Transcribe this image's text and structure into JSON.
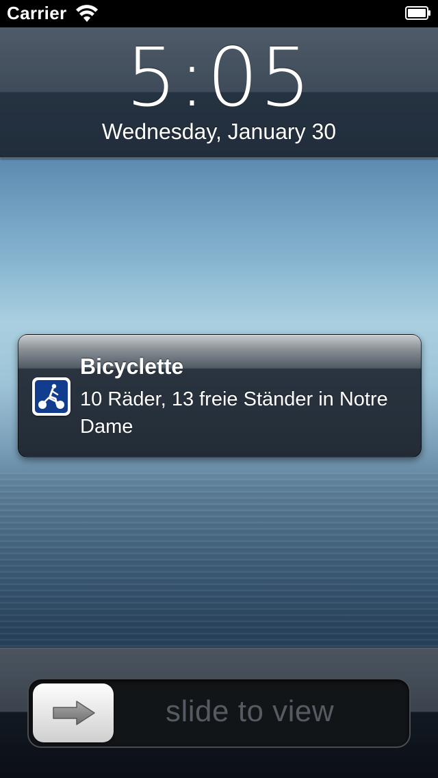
{
  "status_bar": {
    "carrier": "Carrier",
    "wifi_icon": "wifi-icon",
    "battery_icon": "battery-icon"
  },
  "lock_screen": {
    "time": "5:05",
    "date": "Wednesday, January 30"
  },
  "notification": {
    "app_name": "Bicyclette",
    "message": "10 Räder, 13 freie Ständer in Notre Dame",
    "icon": "bicycle-app-icon",
    "icon_color": "#123d8f"
  },
  "unlock_slider": {
    "label": "slide to view",
    "knob_icon": "arrow-right-icon"
  },
  "colors": {
    "status_bar_bg": "#000000",
    "text": "#ffffff",
    "slider_text": "#555b62"
  }
}
